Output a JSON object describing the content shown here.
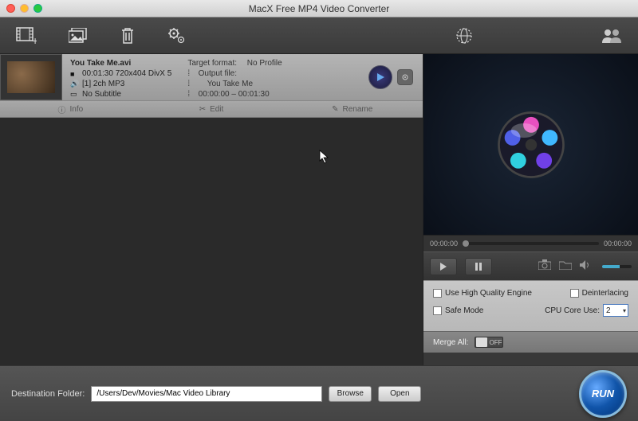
{
  "window": {
    "title": "MacX Free MP4 Video Converter"
  },
  "file": {
    "name": "You Take Me.avi",
    "video_info": "00:01:30 720x404 DivX 5",
    "audio_info": "[1] 2ch MP3",
    "subtitle": "No Subtitle",
    "target_format_label": "Target format:",
    "target_format": "No Profile",
    "output_file_label": "Output file:",
    "output_file": "You Take Me",
    "time_range": "00:00:00 – 00:01:30"
  },
  "actions": {
    "info": "Info",
    "edit": "Edit",
    "rename": "Rename"
  },
  "preview": {
    "time_start": "00:00:00",
    "time_end": "00:00:00"
  },
  "options": {
    "hq": "Use High Quality Engine",
    "deint": "Deinterlacing",
    "safe": "Safe Mode",
    "cpu_label": "CPU Core Use:",
    "cpu_value": "2",
    "merge_label": "Merge All:",
    "merge_state": "OFF"
  },
  "dest": {
    "label": "Destination Folder:",
    "path": "/Users/Dev/Movies/Mac Video Library",
    "browse": "Browse",
    "open": "Open"
  },
  "run": "RUN"
}
